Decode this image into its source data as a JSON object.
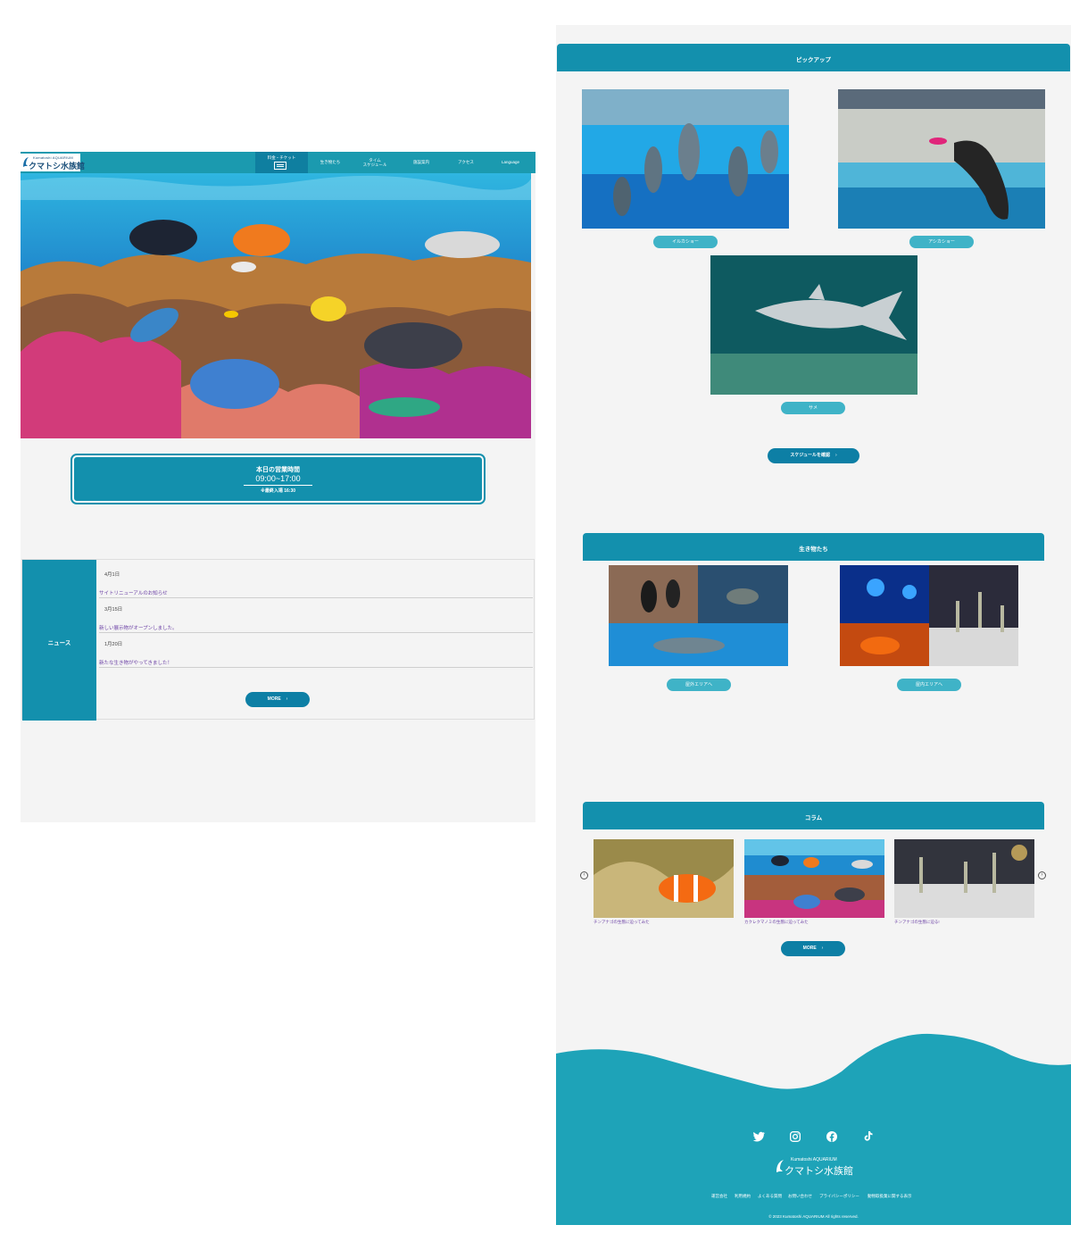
{
  "header": {
    "logo_small": "Kumatoshi  AQUARIUM",
    "logo_big": "クマトシ水族館",
    "nav": [
      {
        "label": "料金・チケット"
      },
      {
        "label": "生き物たち"
      },
      {
        "label": "タイム\nスケジュール"
      },
      {
        "label": "施設案内"
      },
      {
        "label": "アクセス"
      },
      {
        "label": "Language"
      }
    ]
  },
  "hours": {
    "title": "本日の営業時間",
    "time": "09:00~17:00",
    "note": "※最終入場 16:30"
  },
  "news": {
    "heading": "ニュース",
    "items": [
      {
        "date": "4月1日",
        "title": "サイトリニューアルのお知らせ"
      },
      {
        "date": "3月15日",
        "title": "新しい展示物がオープンしました。"
      },
      {
        "date": "1月20日",
        "title": "新たな生き物がやってきました！"
      }
    ],
    "more_label": "MORE"
  },
  "pickup": {
    "heading": "ピックアップ",
    "items": [
      {
        "label": "イルカショー"
      },
      {
        "label": "アシカショー"
      },
      {
        "label": "サメ"
      }
    ],
    "schedule_label": "スケジュールを確認"
  },
  "creatures": {
    "heading": "生き物たち",
    "items": [
      {
        "label": "屋外エリアへ"
      },
      {
        "label": "屋内エリアへ"
      }
    ]
  },
  "column": {
    "heading": "コラム",
    "items": [
      {
        "caption": "チンアナゴの生態に迫ってみた"
      },
      {
        "caption": "カクレクマノミの生態に迫ってみた"
      },
      {
        "caption": "チンアナゴの生態に迫る!"
      }
    ],
    "more_label": "MORE"
  },
  "footer": {
    "social_icons": [
      "twitter-icon",
      "instagram-icon",
      "facebook-icon",
      "tiktok-icon"
    ],
    "logo_small": "Kumatoshi  AQUARIUM",
    "logo_big": "クマトシ水族館",
    "links": [
      "運営会社",
      "利用規約",
      "よくある質問",
      "お問い合わせ",
      "プライバシーポリシー",
      "動物取扱業に関する表示"
    ],
    "copyright": "© 2023 Kumatoshi AQUARIUM All rights reserved."
  },
  "colors": {
    "primary": "#1390ad",
    "accent": "#3fb3c7",
    "footer": "#1ea3b8",
    "background": "#f4f4f4",
    "link": "#6a3fa4"
  }
}
